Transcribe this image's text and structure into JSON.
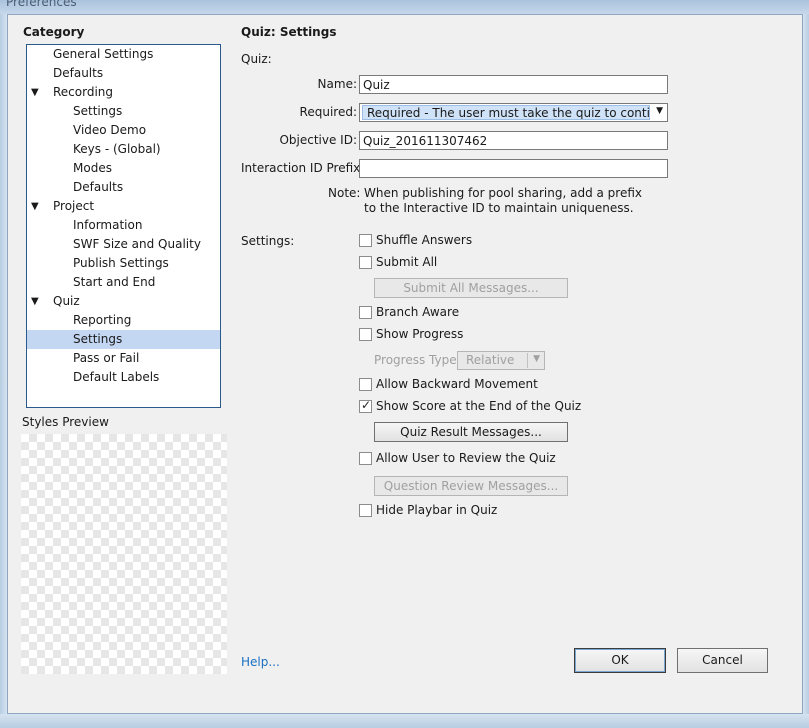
{
  "window": {
    "title": "Preferences"
  },
  "sidebar": {
    "heading": "Category",
    "items": [
      {
        "label": "General Settings",
        "indent": 1,
        "twisty": ""
      },
      {
        "label": "Defaults",
        "indent": 1,
        "twisty": ""
      },
      {
        "label": "Recording",
        "indent": 1,
        "twisty": "▼"
      },
      {
        "label": "Settings",
        "indent": 2,
        "twisty": ""
      },
      {
        "label": "Video Demo",
        "indent": 2,
        "twisty": ""
      },
      {
        "label": "Keys - (Global)",
        "indent": 2,
        "twisty": ""
      },
      {
        "label": "Modes",
        "indent": 2,
        "twisty": ""
      },
      {
        "label": "Defaults",
        "indent": 2,
        "twisty": ""
      },
      {
        "label": "Project",
        "indent": 1,
        "twisty": "▼"
      },
      {
        "label": "Information",
        "indent": 2,
        "twisty": ""
      },
      {
        "label": "SWF Size and Quality",
        "indent": 2,
        "twisty": ""
      },
      {
        "label": "Publish Settings",
        "indent": 2,
        "twisty": ""
      },
      {
        "label": "Start and End",
        "indent": 2,
        "twisty": ""
      },
      {
        "label": "Quiz",
        "indent": 1,
        "twisty": "▼"
      },
      {
        "label": "Reporting",
        "indent": 2,
        "twisty": ""
      },
      {
        "label": "Settings",
        "indent": 2,
        "twisty": "",
        "selected": true
      },
      {
        "label": "Pass or Fail",
        "indent": 2,
        "twisty": ""
      },
      {
        "label": "Default Labels",
        "indent": 2,
        "twisty": ""
      }
    ],
    "preview_heading": "Styles Preview"
  },
  "panel": {
    "title": "Quiz: Settings",
    "quiz_section": "Quiz:",
    "name_label": "Name:",
    "name_value": "Quiz",
    "required_label": "Required:",
    "required_value": "Required - The user must take the quiz to contin...",
    "objective_label": "Objective ID:",
    "objective_value": "Quiz_201611307462",
    "interaction_label": "Interaction ID Prefix:",
    "interaction_value": "",
    "note_label": "Note:",
    "note_text": "When publishing for pool sharing, add a prefix to the Interactive ID to maintain uniqueness.",
    "settings_section": "Settings:",
    "options": {
      "shuffle": {
        "label": "Shuffle Answers",
        "checked": false
      },
      "submit_all": {
        "label": "Submit All",
        "checked": false
      },
      "branch_aware": {
        "label": "Branch Aware",
        "checked": false
      },
      "show_progress": {
        "label": "Show Progress",
        "checked": false
      },
      "allow_backward": {
        "label": "Allow Backward Movement",
        "checked": false
      },
      "show_score": {
        "label": "Show Score at the End of the Quiz",
        "checked": true
      },
      "allow_review": {
        "label": "Allow User to Review the Quiz",
        "checked": false
      },
      "hide_playbar": {
        "label": "Hide Playbar in Quiz",
        "checked": false
      }
    },
    "submit_all_messages_button": "Submit All Messages...",
    "progress_type_label": "Progress Type:",
    "progress_type_value": "Relative",
    "quiz_result_messages_button": "Quiz Result Messages...",
    "question_review_messages_button": "Question Review Messages..."
  },
  "footer": {
    "help_link": "Help...",
    "ok_button": "OK",
    "cancel_button": "Cancel"
  },
  "icons": {
    "twisty": "expanded-triangle-icon",
    "dropdown_arrow": "chevron-down-icon",
    "checkmark": "checkmark-icon"
  },
  "colors": {
    "selection": "#c3d6f2",
    "link": "#1a70c2",
    "tree_border": "#2a5a8c"
  }
}
